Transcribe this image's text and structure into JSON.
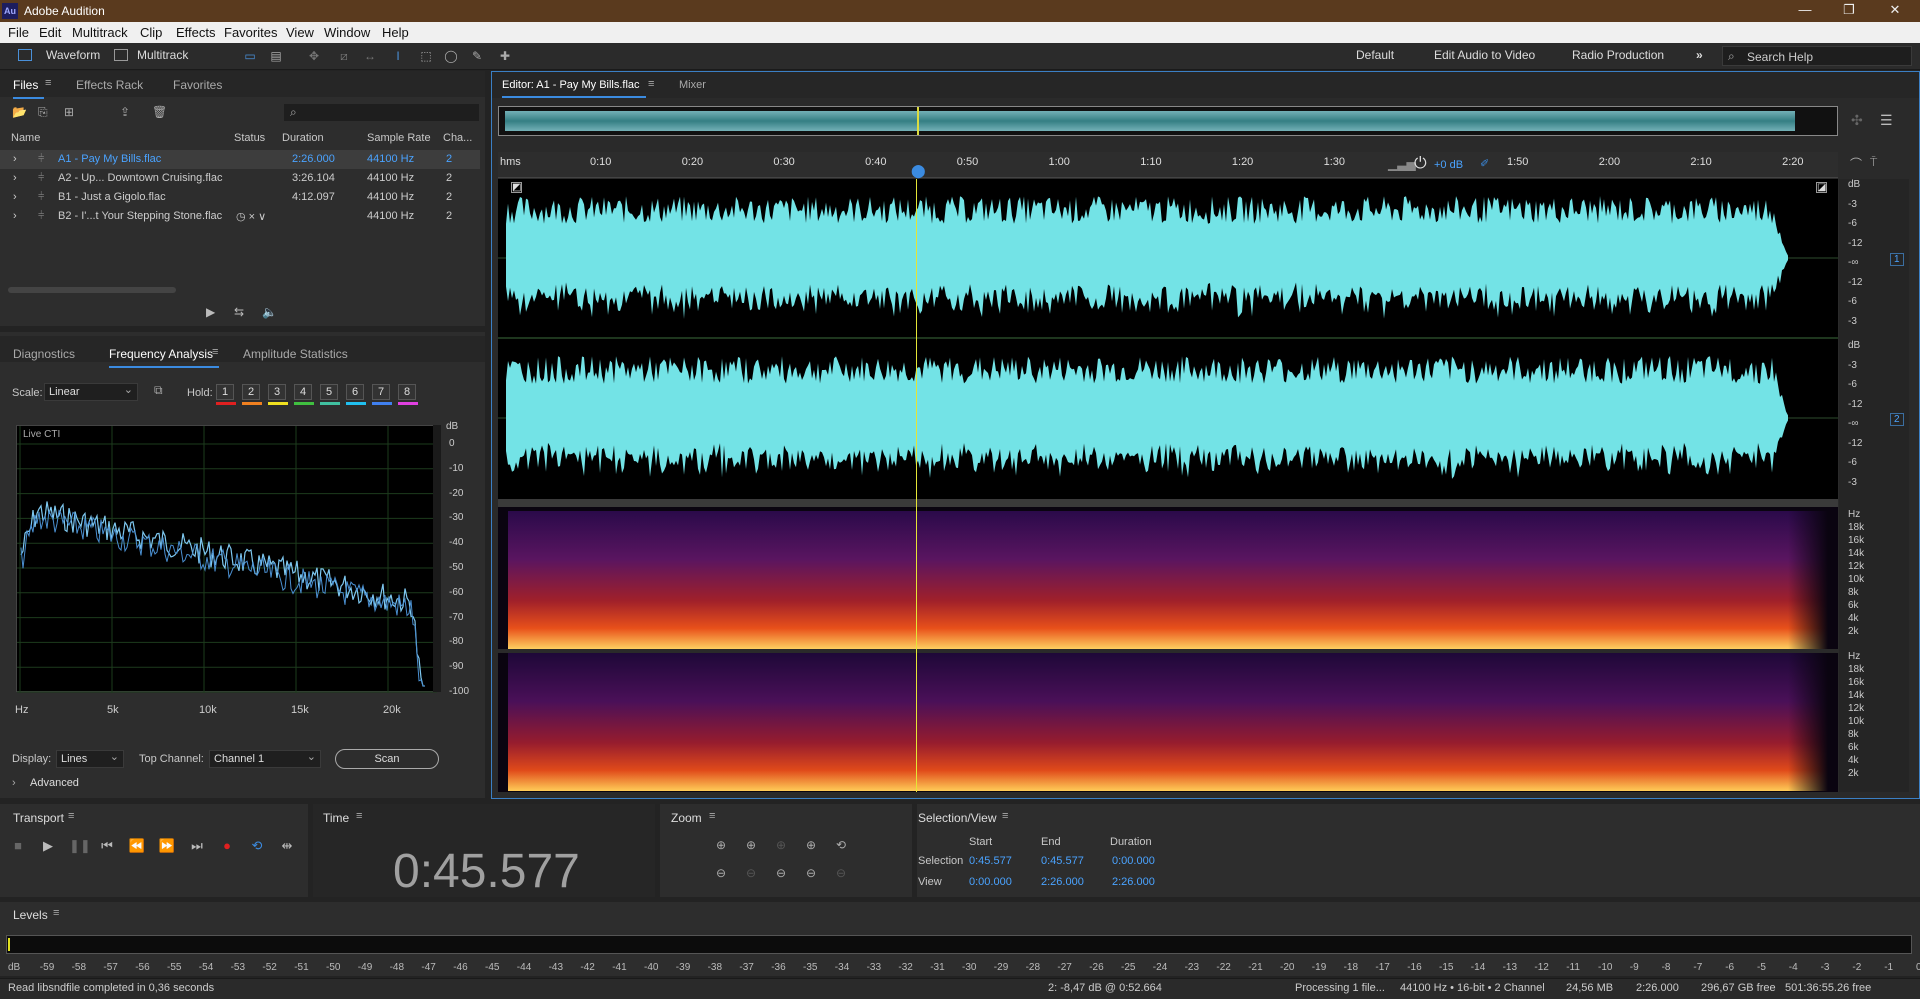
{
  "app": {
    "title": "Adobe Audition",
    "logo": "Au"
  },
  "menu": [
    "File",
    "Edit",
    "Multitrack",
    "Clip",
    "Effects",
    "Favorites",
    "View",
    "Window",
    "Help"
  ],
  "toolbar": {
    "waveform": "Waveform",
    "multitrack": "Multitrack",
    "workspaces": [
      "Default",
      "Edit Audio to Video",
      "Radio Production"
    ],
    "search_placeholder": "Search Help"
  },
  "files": {
    "tabs": [
      "Files",
      "Effects Rack",
      "Favorites"
    ],
    "columns": [
      "Name",
      "Status",
      "Duration",
      "Sample Rate",
      "Cha..."
    ],
    "rows": [
      {
        "name": "A1 - Pay My Bills.flac",
        "status": "",
        "duration": "2:26.000",
        "rate": "44100 Hz",
        "ch": "2"
      },
      {
        "name": "A2 - Up... Downtown Cruising.flac",
        "status": "",
        "duration": "3:26.104",
        "rate": "44100 Hz",
        "ch": "2"
      },
      {
        "name": "B1 - Just a Gigolo.flac",
        "status": "",
        "duration": "4:12.097",
        "rate": "44100 Hz",
        "ch": "2"
      },
      {
        "name": "B2 - I'...t Your Stepping Stone.flac",
        "status": "◷ × ∨",
        "duration": "",
        "rate": "44100 Hz",
        "ch": "2"
      }
    ]
  },
  "analysis": {
    "tabs": [
      "Diagnostics",
      "Frequency Analysis",
      "Amplitude Statistics"
    ],
    "scale_label": "Scale:",
    "scale_value": "Linear",
    "hold_label": "Hold:",
    "holds": [
      "1",
      "2",
      "3",
      "4",
      "5",
      "6",
      "7",
      "8"
    ],
    "hold_colors": [
      "#e02020",
      "#f08020",
      "#f0e020",
      "#40c040",
      "#40c0a0",
      "#20c0f0",
      "#4080f0",
      "#e040e0"
    ],
    "live": "Live CTI",
    "db_unit": "dB",
    "db_ticks": [
      "0",
      "-10",
      "-20",
      "-30",
      "-40",
      "-50",
      "-60",
      "-70",
      "-80",
      "-90",
      "-100"
    ],
    "x_ticks": [
      "Hz",
      "5k",
      "10k",
      "15k",
      "20k"
    ],
    "display_label": "Display:",
    "display_value": "Lines",
    "top_channel_label": "Top Channel:",
    "top_channel_value": "Channel 1",
    "scan": "Scan",
    "advanced": "Advanced"
  },
  "editor": {
    "tab": "Editor: A1 - Pay My Bills.flac",
    "mixer": "Mixer",
    "ruler": [
      "hms",
      "0:10",
      "0:20",
      "0:30",
      "0:40",
      "0:50",
      "1:00",
      "1:10",
      "1:20",
      "1:30",
      "1:40",
      "1:50",
      "2:00",
      "2:10",
      "2:20"
    ],
    "gain": "+0 dB",
    "db_scale_1": [
      "dB",
      "-3",
      "-6",
      "-12",
      "-∞",
      "-12",
      "-6",
      "-3"
    ],
    "db_scale_2": [
      "dB",
      "-3",
      "-6",
      "-12",
      "-∞",
      "-12",
      "-6",
      "-3"
    ],
    "ch1": "1",
    "ch2": "2",
    "hz_scale": [
      "Hz",
      "18k",
      "16k",
      "14k",
      "12k",
      "10k",
      "8k",
      "6k",
      "4k",
      "2k"
    ]
  },
  "transport": {
    "title": "Transport"
  },
  "time": {
    "title": "Time",
    "value": "0:45.577"
  },
  "zoom": {
    "title": "Zoom"
  },
  "selection": {
    "title": "Selection/View",
    "start": "Start",
    "end": "End",
    "duration": "Duration",
    "sel_label": "Selection",
    "view_label": "View",
    "sel_start": "0:45.577",
    "sel_end": "0:45.577",
    "sel_dur": "0:00.000",
    "view_start": "0:00.000",
    "view_end": "2:26.000",
    "view_dur": "2:26.000"
  },
  "levels": {
    "title": "Levels",
    "ticks": [
      "dB",
      "-59",
      "-58",
      "-57",
      "-56",
      "-55",
      "-54",
      "-53",
      "-52",
      "-51",
      "-50",
      "-49",
      "-48",
      "-47",
      "-46",
      "-45",
      "-44",
      "-43",
      "-42",
      "-41",
      "-40",
      "-39",
      "-38",
      "-37",
      "-36",
      "-35",
      "-34",
      "-33",
      "-32",
      "-31",
      "-30",
      "-29",
      "-28",
      "-27",
      "-26",
      "-25",
      "-24",
      "-23",
      "-22",
      "-21",
      "-20",
      "-19",
      "-18",
      "-17",
      "-16",
      "-15",
      "-14",
      "-13",
      "-12",
      "-11",
      "-10",
      "-9",
      "-8",
      "-7",
      "-6",
      "-5",
      "-4",
      "-3",
      "-2",
      "-1",
      "0"
    ]
  },
  "status": {
    "left": "Read libsndfile completed in 0,36 seconds",
    "cursor": "2: -8,47 dB @ 0:52.664",
    "processing": "Processing 1 file...",
    "format": "44100 Hz • 16-bit • 2 Channel",
    "size": "24,56 MB",
    "dur": "2:26.000",
    "free": "296,67 GB free",
    "time_free": "501:36:55.26 free"
  }
}
